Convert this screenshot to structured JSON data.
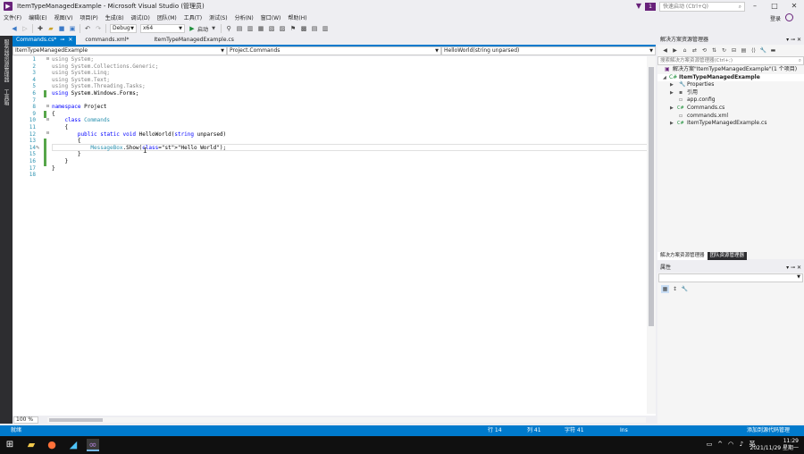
{
  "window": {
    "title": "ItemTypeManagedExample - Microsoft Visual Studio (管理员)",
    "notification_count": "1",
    "quick_launch_placeholder": "快速启动 (Ctrl+Q)"
  },
  "menu": {
    "items": [
      "文件(F)",
      "编辑(E)",
      "视图(V)",
      "项目(P)",
      "生成(B)",
      "调试(D)",
      "团队(M)",
      "工具(T)",
      "测试(S)",
      "分析(N)",
      "窗口(W)",
      "帮助(H)"
    ],
    "login": "登录"
  },
  "toolbar": {
    "config": "Debug",
    "platform": "x64",
    "start": "启动"
  },
  "left_strip": {
    "text1": "服务器资源管理器",
    "text2": "工具箱"
  },
  "tabs": [
    {
      "label": "Commands.cs*",
      "active": true
    },
    {
      "label": "commands.xml*",
      "active": false
    },
    {
      "label": "ItemTypeManagedExample.cs",
      "active": false
    }
  ],
  "navbar": {
    "project": "ItemTypeManagedExample",
    "type": "Project.Commands",
    "member": "HelloWorld(string unparsed)"
  },
  "code": {
    "lines": [
      {
        "n": "1",
        "text": "using System;"
      },
      {
        "n": "2",
        "text": "using System.Collections.Generic;"
      },
      {
        "n": "3",
        "text": "using System.Linq;"
      },
      {
        "n": "4",
        "text": "using System.Text;"
      },
      {
        "n": "5",
        "text": "using System.Threading.Tasks;"
      },
      {
        "n": "6",
        "text": "using System.Windows.Forms;"
      },
      {
        "n": "7",
        "text": ""
      },
      {
        "n": "8",
        "text": "namespace Project"
      },
      {
        "n": "9",
        "text": "{"
      },
      {
        "n": "10",
        "text": "    class Commands"
      },
      {
        "n": "11",
        "text": "    {"
      },
      {
        "n": "12",
        "text": "        public static void HelloWorld(string unparsed)"
      },
      {
        "n": "13",
        "text": "        {"
      },
      {
        "n": "14",
        "text": "            MessageBox.Show(\"Hello World\");"
      },
      {
        "n": "15",
        "text": "        }"
      },
      {
        "n": "16",
        "text": "    }"
      },
      {
        "n": "17",
        "text": "}"
      },
      {
        "n": "18",
        "text": ""
      }
    ]
  },
  "zoom": "100 %",
  "solution_explorer": {
    "title": "解决方案资源管理器",
    "search_placeholder": "搜索解决方案资源管理器(Ctrl+;)",
    "items": [
      {
        "label": "解决方案\"ItemTypeManagedExample\"(1 个项目)",
        "icon": "solution-icon",
        "level": 0
      },
      {
        "label": "ItemTypeManagedExample",
        "icon": "csharp-project-icon",
        "level": 1,
        "bold": true,
        "expanded": true
      },
      {
        "label": "Properties",
        "icon": "wrench-icon",
        "level": 2,
        "expandable": true
      },
      {
        "label": "引用",
        "icon": "references-icon",
        "level": 2,
        "expandable": true
      },
      {
        "label": "app.config",
        "icon": "config-file-icon",
        "level": 2
      },
      {
        "label": "Commands.cs",
        "icon": "csharp-file-icon",
        "level": 2,
        "expandable": true
      },
      {
        "label": "commands.xml",
        "icon": "xml-file-icon",
        "level": 2
      },
      {
        "label": "ItemTypeManagedExample.cs",
        "icon": "csharp-file-icon",
        "level": 2,
        "expandable": true
      }
    ],
    "tab_active": "解决方案资源管理器",
    "tab_other": "团队资源管理器"
  },
  "properties": {
    "title": "属性"
  },
  "statusbar": {
    "ready": "就绪",
    "line": "行 14",
    "col": "列 41",
    "char": "字符 41",
    "ins": "Ins",
    "source_control": "添加到源代码管理"
  },
  "taskbar": {
    "time": "11:29",
    "date": "2021/11/29 星期一"
  },
  "colors": {
    "accent": "#007acc",
    "vs_purple": "#68217a",
    "keyword": "#0000ff",
    "type": "#2b91af",
    "string": "#a31515",
    "comment_gray": "#808080"
  }
}
